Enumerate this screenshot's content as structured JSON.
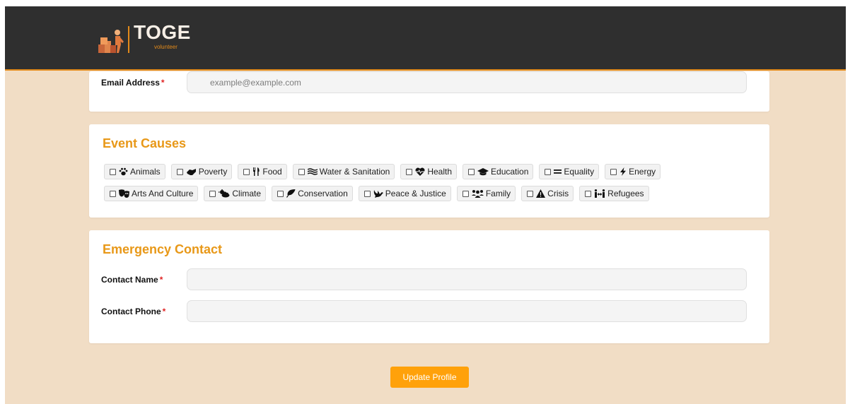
{
  "brand": {
    "title": "TOGE",
    "subtitle": "volunteer"
  },
  "contact": {
    "email_label": "Email Address",
    "email_placeholder": "example@example.com",
    "required_mark": "*"
  },
  "causes": {
    "title": "Event Causes",
    "row1": [
      {
        "label": "Animals",
        "icon": "paw-icon"
      },
      {
        "label": "Poverty",
        "icon": "handshake-icon"
      },
      {
        "label": "Food",
        "icon": "utensils-icon"
      },
      {
        "label": "Water & Sanitation",
        "icon": "water-icon"
      },
      {
        "label": "Health",
        "icon": "heartbeat-icon"
      },
      {
        "label": "Education",
        "icon": "graduation-cap-icon"
      },
      {
        "label": "Equality",
        "icon": "equals-icon"
      },
      {
        "label": "Energy",
        "icon": "bolt-icon"
      }
    ],
    "row2": [
      {
        "label": "Arts And Culture",
        "icon": "theater-masks-icon"
      },
      {
        "label": "Climate",
        "icon": "cloud-sun-icon"
      },
      {
        "label": "Conservation",
        "icon": "leaf-icon"
      },
      {
        "label": "Peace & Justice",
        "icon": "dove-icon"
      },
      {
        "label": "Family",
        "icon": "users-icon"
      },
      {
        "label": "Crisis",
        "icon": "warning-icon"
      },
      {
        "label": "Refugees",
        "icon": "people-arrows-icon"
      }
    ]
  },
  "emergency": {
    "title": "Emergency Contact",
    "name_label": "Contact Name",
    "phone_label": "Contact Phone",
    "name_value": "",
    "phone_value": "",
    "required_mark": "*"
  },
  "actions": {
    "update_label": "Update Profile"
  },
  "colors": {
    "header_bg": "#2f2f2f",
    "accent": "#e89818",
    "page_bg": "#f1ddc5",
    "button": "#ffa10a",
    "required": "#e02424"
  }
}
